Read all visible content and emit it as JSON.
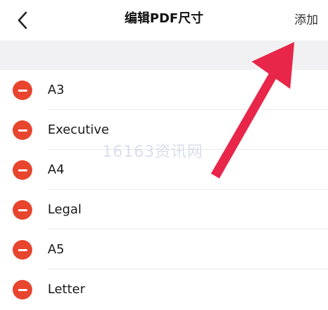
{
  "header": {
    "back_icon": "chevron-left-icon",
    "title": "编辑PDF尺寸",
    "add_label": "添加"
  },
  "paper_sizes": [
    {
      "label": "A3"
    },
    {
      "label": "Executive"
    },
    {
      "label": "A4"
    },
    {
      "label": "Legal"
    },
    {
      "label": "A5"
    },
    {
      "label": "Letter"
    }
  ],
  "delete_icon": "minus-circle-icon",
  "watermark": "16163资讯网",
  "colors": {
    "delete_red": "#e8452f",
    "arrow_red": "#e8264a",
    "section_gap": "#f1f1f3"
  }
}
